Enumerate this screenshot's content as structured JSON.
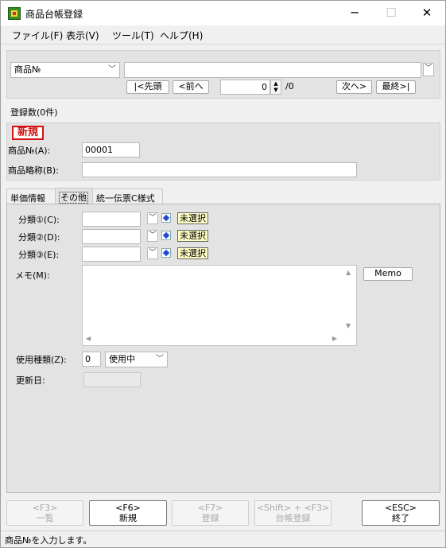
{
  "window": {
    "title": "商品台帳登録",
    "minimize": "─",
    "maximize": "☐",
    "close": "✕"
  },
  "menu": {
    "file": "ファイル(F)",
    "view": "表示(V)",
    "tools": "ツール(T)",
    "help": "ヘルプ(H)"
  },
  "search": {
    "field_select": "商品№",
    "search_value": "",
    "first": "|<先頭",
    "prev": "<前へ",
    "page_current": "0",
    "page_total": "/0",
    "next": "次へ>",
    "last": "最終>|"
  },
  "registered_count": "登録数(0件)",
  "record": {
    "status_badge": "新規",
    "product_no_label": "商品№(A):",
    "product_no_value": "00001",
    "short_name_label": "商品略称(B):",
    "short_name_value": ""
  },
  "tabs": [
    "単価情報",
    "その他",
    "統一伝票C様式"
  ],
  "other": {
    "cat1_label": "分類①(C):",
    "cat2_label": "分類②(D):",
    "cat3_label": "分類③(E):",
    "cat1_value": "",
    "cat2_value": "",
    "cat3_value": "",
    "unselected": "未選択",
    "memo_label": "メモ(M):",
    "memo_value": "",
    "memo_button": "Memo",
    "usage_label": "使用種類(Z):",
    "usage_code": "0",
    "usage_select": "使用中",
    "updated_label": "更新日:",
    "updated_value": ""
  },
  "fkeys": {
    "f3_key": "<F3>",
    "f3_label": "一覧",
    "f6_key": "<F6>",
    "f6_label": "新規",
    "f7_key": "<F7>",
    "f7_label": "登録",
    "sf3_key": "<Shift> + <F3>",
    "sf3_label": "台帳登録",
    "esc_key": "<ESC>",
    "esc_label": "終了"
  },
  "status_message": "商品№を入力します。"
}
